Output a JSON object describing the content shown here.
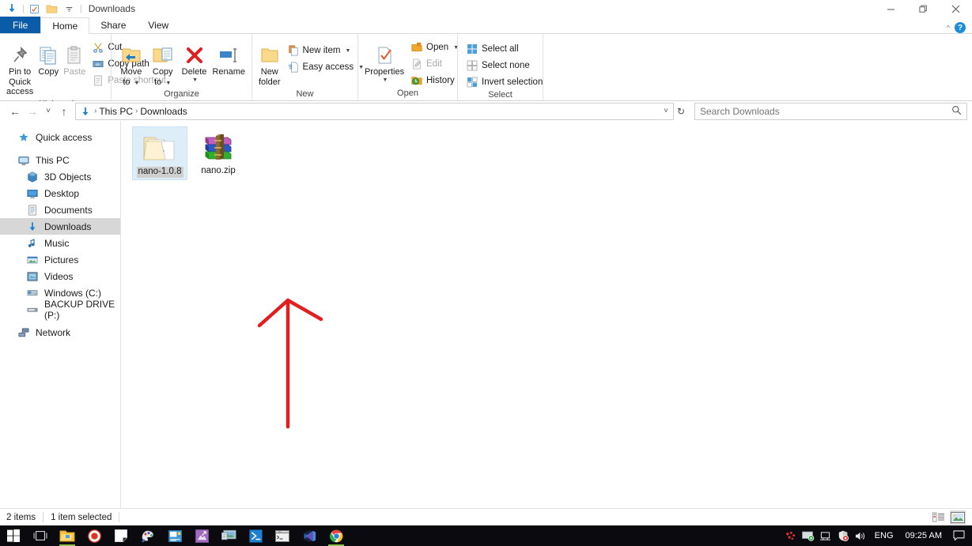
{
  "window": {
    "title": "Downloads",
    "quick_access_icons": [
      "download-arrow-icon",
      "properties-check-icon",
      "new-folder-icon",
      "customize-chevron-icon"
    ],
    "minimize_label": "—",
    "maximize_label": "❐",
    "close_label": "×",
    "collapse_ribbon_label": "^",
    "help_label": "?"
  },
  "tabs": [
    {
      "label": "File",
      "state": "file"
    },
    {
      "label": "Home",
      "state": "active"
    },
    {
      "label": "Share",
      "state": "normal"
    },
    {
      "label": "View",
      "state": "normal"
    }
  ],
  "ribbon": {
    "groups": [
      {
        "name": "Clipboard",
        "label": "Clipboard",
        "big_buttons": [
          {
            "label": "Pin to Quick\naccess",
            "icon": "pin-icon",
            "disabled": false
          },
          {
            "label": "Copy",
            "icon": "copy-icon",
            "disabled": false
          },
          {
            "label": "Paste",
            "icon": "paste-icon",
            "disabled": true
          }
        ],
        "small_buttons": [
          {
            "label": "Cut",
            "icon": "scissors-icon",
            "disabled": false
          },
          {
            "label": "Copy path",
            "icon": "copy-path-icon",
            "disabled": false
          },
          {
            "label": "Paste shortcut",
            "icon": "paste-shortcut-icon",
            "disabled": true
          }
        ]
      },
      {
        "name": "Organize",
        "label": "Organize",
        "big_buttons": [
          {
            "label": "Move\nto",
            "icon": "move-to-icon",
            "dropdown": true
          },
          {
            "label": "Copy\nto",
            "icon": "copy-to-icon",
            "dropdown": true
          },
          {
            "label": "Delete",
            "icon": "delete-x-icon",
            "dropdown": true
          },
          {
            "label": "Rename",
            "icon": "rename-icon",
            "dropdown": false
          }
        ]
      },
      {
        "name": "New",
        "label": "New",
        "big_buttons": [
          {
            "label": "New\nfolder",
            "icon": "new-folder-icon"
          }
        ],
        "small_buttons": [
          {
            "label": "New item",
            "icon": "new-item-icon",
            "dropdown": true
          },
          {
            "label": "Easy access",
            "icon": "easy-access-icon",
            "dropdown": true
          }
        ]
      },
      {
        "name": "Open",
        "label": "Open",
        "big_buttons": [
          {
            "label": "Properties",
            "icon": "properties-icon",
            "dropdown": true
          }
        ],
        "small_buttons": [
          {
            "label": "Open",
            "icon": "open-folder-icon",
            "dropdown": true,
            "disabled": false
          },
          {
            "label": "Edit",
            "icon": "edit-icon",
            "disabled": true
          },
          {
            "label": "History",
            "icon": "history-icon",
            "disabled": false
          }
        ]
      },
      {
        "name": "Select",
        "label": "Select",
        "small_buttons": [
          {
            "label": "Select all",
            "icon": "select-all-icon"
          },
          {
            "label": "Select none",
            "icon": "select-none-icon"
          },
          {
            "label": "Invert selection",
            "icon": "invert-selection-icon"
          }
        ]
      }
    ]
  },
  "addressbar": {
    "back_icon": "back-arrow-icon",
    "forward_icon": "forward-arrow-icon",
    "recent_icon": "recent-locations-chevron-icon",
    "up_icon": "up-arrow-icon",
    "path_icon": "download-arrow-icon",
    "breadcrumbs": [
      "This PC",
      "Downloads"
    ],
    "separator": "›",
    "dropdown_icon": "chevron-down-icon",
    "refresh_icon": "refresh-icon"
  },
  "search": {
    "placeholder": "Search Downloads",
    "value": "",
    "icon": "search-icon"
  },
  "navpane": {
    "items": [
      {
        "label": "Quick access",
        "icon": "star-icon",
        "level": 0,
        "selected": false,
        "gap_after": true
      },
      {
        "label": "This PC",
        "icon": "pc-monitor-icon",
        "level": 0,
        "selected": false
      },
      {
        "label": "3D Objects",
        "icon": "3d-objects-icon",
        "level": 1,
        "selected": false
      },
      {
        "label": "Desktop",
        "icon": "desktop-icon",
        "level": 1,
        "selected": false
      },
      {
        "label": "Documents",
        "icon": "documents-icon",
        "level": 1,
        "selected": false
      },
      {
        "label": "Downloads",
        "icon": "download-arrow-icon",
        "level": 1,
        "selected": true
      },
      {
        "label": "Music",
        "icon": "music-note-icon",
        "level": 1,
        "selected": false
      },
      {
        "label": "Pictures",
        "icon": "pictures-icon",
        "level": 1,
        "selected": false
      },
      {
        "label": "Videos",
        "icon": "videos-icon",
        "level": 1,
        "selected": false
      },
      {
        "label": "Windows (C:)",
        "icon": "hard-drive-icon",
        "level": 1,
        "selected": false
      },
      {
        "label": "BACKUP DRIVE (P:)",
        "icon": "external-drive-icon",
        "level": 1,
        "selected": false,
        "gap_after": true
      },
      {
        "label": "Network",
        "icon": "network-icon",
        "level": 0,
        "selected": false
      }
    ]
  },
  "files": [
    {
      "name": "nano-1.0.8",
      "icon": "folder-icon",
      "type": "folder",
      "selected": true
    },
    {
      "name": "nano.zip",
      "icon": "winrar-archive-icon",
      "type": "archive",
      "selected": false
    }
  ],
  "statusbar": {
    "item_count": "2 items",
    "selection": "1 item selected",
    "view_details_icon": "details-view-icon",
    "view_icons_icon": "large-icons-view-icon",
    "active_view": "large-icons-view-icon"
  },
  "taskbar": {
    "start_icon": "windows-start-icon",
    "task_view_icon": "task-view-icon",
    "items": [
      {
        "icon": "file-explorer-icon",
        "running": true
      },
      {
        "icon": "record-circle-icon",
        "running": false
      },
      {
        "icon": "sticky-note-icon",
        "running": false
      },
      {
        "icon": "paint-net-icon",
        "running": false
      },
      {
        "icon": "photos-icon",
        "running": false
      },
      {
        "icon": "purple-app-icon",
        "running": false
      },
      {
        "icon": "remote-desktop-icon",
        "running": false
      },
      {
        "icon": "powershell-icon",
        "running": false
      },
      {
        "icon": "command-prompt-icon",
        "running": false
      },
      {
        "icon": "visual-studio-icon",
        "running": false
      },
      {
        "icon": "google-chrome-icon",
        "running": true
      }
    ],
    "tray": [
      {
        "icon": "red-dots-icon"
      },
      {
        "icon": "green-display-icon"
      },
      {
        "icon": "network-monitor-icon"
      },
      {
        "icon": "security-shield-alert-icon"
      },
      {
        "icon": "volume-icon"
      }
    ],
    "language": "ENG",
    "clock": "09:25 AM",
    "action_center_icon": "action-center-icon"
  },
  "annotation": {
    "type": "red-arrow",
    "color": "#e02020",
    "points_to": "nano-1.0.8"
  }
}
